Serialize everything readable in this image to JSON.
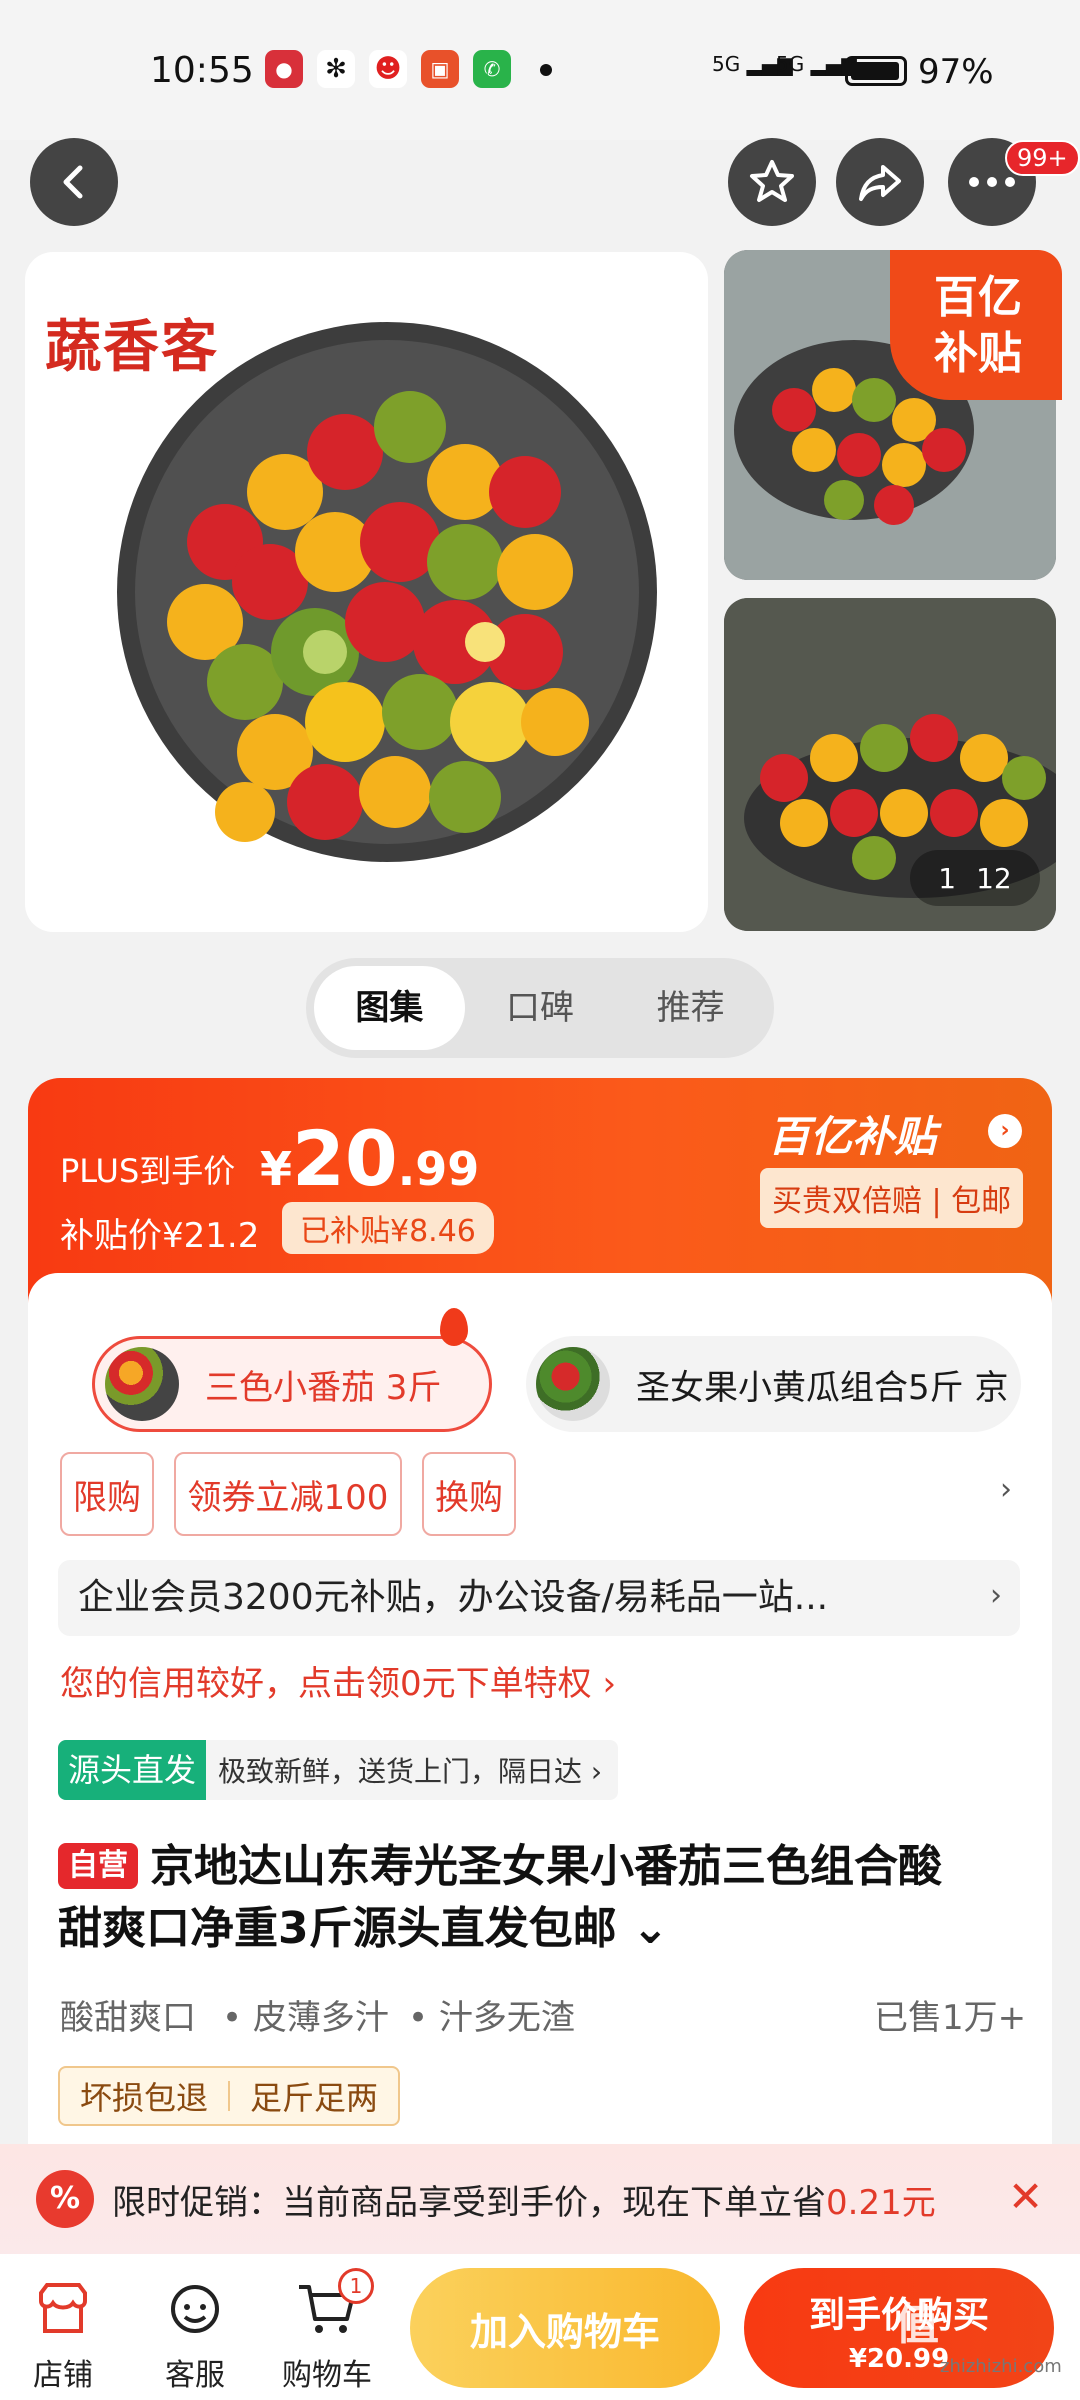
{
  "status_bar": {
    "time": "10:55",
    "signal_1": "5G",
    "signal_2": "5G",
    "battery": "97%"
  },
  "header": {
    "back_icon": "chevron-left-icon",
    "favorite_icon": "star-icon",
    "share_icon": "share-icon",
    "more_icon": "more-icon",
    "more_badge": "99+"
  },
  "gallery": {
    "brand_logo": "蔬香客",
    "subsidy_badge_line1": "百亿",
    "subsidy_badge_line2": "补贴",
    "counter_current": "1",
    "counter_total": "12"
  },
  "tabs": [
    {
      "label": "图集",
      "active": true
    },
    {
      "label": "口碑",
      "active": false
    },
    {
      "label": "推荐",
      "active": false
    }
  ],
  "price": {
    "plus_label": "PLUS到手价",
    "currency": "¥",
    "integer": "20",
    "decimal": ".99",
    "subsidy_price": "补贴价¥21.2",
    "subsidized": "已补贴¥8.46",
    "program_logo": "百亿补贴",
    "guarantee": "买贵双倍赔 | 包邮"
  },
  "variants": [
    {
      "label": "三色小番茄 3斤",
      "selected": true
    },
    {
      "label": "圣女果小黄瓜组合5斤 京",
      "selected": false
    }
  ],
  "promo_chips": [
    "限购",
    "领券立减100",
    "换购"
  ],
  "enterprise_text": "企业会员3200元补贴，办公设备/易耗品一站...",
  "credit_text": "您的信用较好，点击领0元下单特权 ›",
  "source": {
    "tag": "源头直发",
    "desc": "极致新鲜，送货上门，隔日达 ›"
  },
  "product": {
    "self_operated_tag": "自营",
    "title_line1": "京地达山东寿光圣女果小番茄三色组合酸",
    "title_line2": "甜爽口净重3斤源头直发包邮 ⌄",
    "features": [
      "酸甜爽口",
      "• 皮薄多汁",
      "• 汁多无渣"
    ],
    "sold": "已售1万+",
    "tags": [
      "坏损包退",
      "足斤足两"
    ]
  },
  "promo_bar": {
    "icon": "percent-icon",
    "text": "限时促销：当前商品享受到手价，现在下单立省",
    "save": "0.21元"
  },
  "bottom_nav": {
    "store": "店铺",
    "service": "客服",
    "cart": "购物车",
    "cart_count": "1",
    "add_to_cart": "加入购物车",
    "buy_line1": "到手价购买",
    "buy_line2": "¥20.99"
  },
  "watermark": "zhizhizhi.com",
  "colors": {
    "accent": "#f83a12",
    "subsidy_orange": "#f04a18",
    "cart_button": "#f9b82e",
    "source_green": "#17b07a"
  }
}
